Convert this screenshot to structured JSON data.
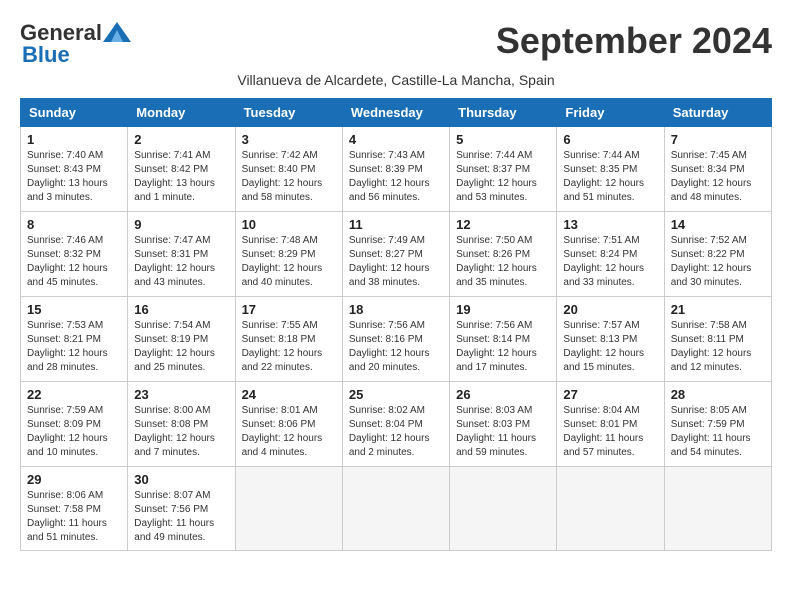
{
  "header": {
    "logo_general": "General",
    "logo_blue": "Blue",
    "month_title": "September 2024",
    "subtitle": "Villanueva de Alcardete, Castille-La Mancha, Spain"
  },
  "days_of_week": [
    "Sunday",
    "Monday",
    "Tuesday",
    "Wednesday",
    "Thursday",
    "Friday",
    "Saturday"
  ],
  "weeks": [
    [
      {
        "day": "1",
        "sunrise": "Sunrise: 7:40 AM",
        "sunset": "Sunset: 8:43 PM",
        "daylight": "Daylight: 13 hours and 3 minutes."
      },
      {
        "day": "2",
        "sunrise": "Sunrise: 7:41 AM",
        "sunset": "Sunset: 8:42 PM",
        "daylight": "Daylight: 13 hours and 1 minute."
      },
      {
        "day": "3",
        "sunrise": "Sunrise: 7:42 AM",
        "sunset": "Sunset: 8:40 PM",
        "daylight": "Daylight: 12 hours and 58 minutes."
      },
      {
        "day": "4",
        "sunrise": "Sunrise: 7:43 AM",
        "sunset": "Sunset: 8:39 PM",
        "daylight": "Daylight: 12 hours and 56 minutes."
      },
      {
        "day": "5",
        "sunrise": "Sunrise: 7:44 AM",
        "sunset": "Sunset: 8:37 PM",
        "daylight": "Daylight: 12 hours and 53 minutes."
      },
      {
        "day": "6",
        "sunrise": "Sunrise: 7:44 AM",
        "sunset": "Sunset: 8:35 PM",
        "daylight": "Daylight: 12 hours and 51 minutes."
      },
      {
        "day": "7",
        "sunrise": "Sunrise: 7:45 AM",
        "sunset": "Sunset: 8:34 PM",
        "daylight": "Daylight: 12 hours and 48 minutes."
      }
    ],
    [
      {
        "day": "8",
        "sunrise": "Sunrise: 7:46 AM",
        "sunset": "Sunset: 8:32 PM",
        "daylight": "Daylight: 12 hours and 45 minutes."
      },
      {
        "day": "9",
        "sunrise": "Sunrise: 7:47 AM",
        "sunset": "Sunset: 8:31 PM",
        "daylight": "Daylight: 12 hours and 43 minutes."
      },
      {
        "day": "10",
        "sunrise": "Sunrise: 7:48 AM",
        "sunset": "Sunset: 8:29 PM",
        "daylight": "Daylight: 12 hours and 40 minutes."
      },
      {
        "day": "11",
        "sunrise": "Sunrise: 7:49 AM",
        "sunset": "Sunset: 8:27 PM",
        "daylight": "Daylight: 12 hours and 38 minutes."
      },
      {
        "day": "12",
        "sunrise": "Sunrise: 7:50 AM",
        "sunset": "Sunset: 8:26 PM",
        "daylight": "Daylight: 12 hours and 35 minutes."
      },
      {
        "day": "13",
        "sunrise": "Sunrise: 7:51 AM",
        "sunset": "Sunset: 8:24 PM",
        "daylight": "Daylight: 12 hours and 33 minutes."
      },
      {
        "day": "14",
        "sunrise": "Sunrise: 7:52 AM",
        "sunset": "Sunset: 8:22 PM",
        "daylight": "Daylight: 12 hours and 30 minutes."
      }
    ],
    [
      {
        "day": "15",
        "sunrise": "Sunrise: 7:53 AM",
        "sunset": "Sunset: 8:21 PM",
        "daylight": "Daylight: 12 hours and 28 minutes."
      },
      {
        "day": "16",
        "sunrise": "Sunrise: 7:54 AM",
        "sunset": "Sunset: 8:19 PM",
        "daylight": "Daylight: 12 hours and 25 minutes."
      },
      {
        "day": "17",
        "sunrise": "Sunrise: 7:55 AM",
        "sunset": "Sunset: 8:18 PM",
        "daylight": "Daylight: 12 hours and 22 minutes."
      },
      {
        "day": "18",
        "sunrise": "Sunrise: 7:56 AM",
        "sunset": "Sunset: 8:16 PM",
        "daylight": "Daylight: 12 hours and 20 minutes."
      },
      {
        "day": "19",
        "sunrise": "Sunrise: 7:56 AM",
        "sunset": "Sunset: 8:14 PM",
        "daylight": "Daylight: 12 hours and 17 minutes."
      },
      {
        "day": "20",
        "sunrise": "Sunrise: 7:57 AM",
        "sunset": "Sunset: 8:13 PM",
        "daylight": "Daylight: 12 hours and 15 minutes."
      },
      {
        "day": "21",
        "sunrise": "Sunrise: 7:58 AM",
        "sunset": "Sunset: 8:11 PM",
        "daylight": "Daylight: 12 hours and 12 minutes."
      }
    ],
    [
      {
        "day": "22",
        "sunrise": "Sunrise: 7:59 AM",
        "sunset": "Sunset: 8:09 PM",
        "daylight": "Daylight: 12 hours and 10 minutes."
      },
      {
        "day": "23",
        "sunrise": "Sunrise: 8:00 AM",
        "sunset": "Sunset: 8:08 PM",
        "daylight": "Daylight: 12 hours and 7 minutes."
      },
      {
        "day": "24",
        "sunrise": "Sunrise: 8:01 AM",
        "sunset": "Sunset: 8:06 PM",
        "daylight": "Daylight: 12 hours and 4 minutes."
      },
      {
        "day": "25",
        "sunrise": "Sunrise: 8:02 AM",
        "sunset": "Sunset: 8:04 PM",
        "daylight": "Daylight: 12 hours and 2 minutes."
      },
      {
        "day": "26",
        "sunrise": "Sunrise: 8:03 AM",
        "sunset": "Sunset: 8:03 PM",
        "daylight": "Daylight: 11 hours and 59 minutes."
      },
      {
        "day": "27",
        "sunrise": "Sunrise: 8:04 AM",
        "sunset": "Sunset: 8:01 PM",
        "daylight": "Daylight: 11 hours and 57 minutes."
      },
      {
        "day": "28",
        "sunrise": "Sunrise: 8:05 AM",
        "sunset": "Sunset: 7:59 PM",
        "daylight": "Daylight: 11 hours and 54 minutes."
      }
    ],
    [
      {
        "day": "29",
        "sunrise": "Sunrise: 8:06 AM",
        "sunset": "Sunset: 7:58 PM",
        "daylight": "Daylight: 11 hours and 51 minutes."
      },
      {
        "day": "30",
        "sunrise": "Sunrise: 8:07 AM",
        "sunset": "Sunset: 7:56 PM",
        "daylight": "Daylight: 11 hours and 49 minutes."
      },
      null,
      null,
      null,
      null,
      null
    ]
  ]
}
